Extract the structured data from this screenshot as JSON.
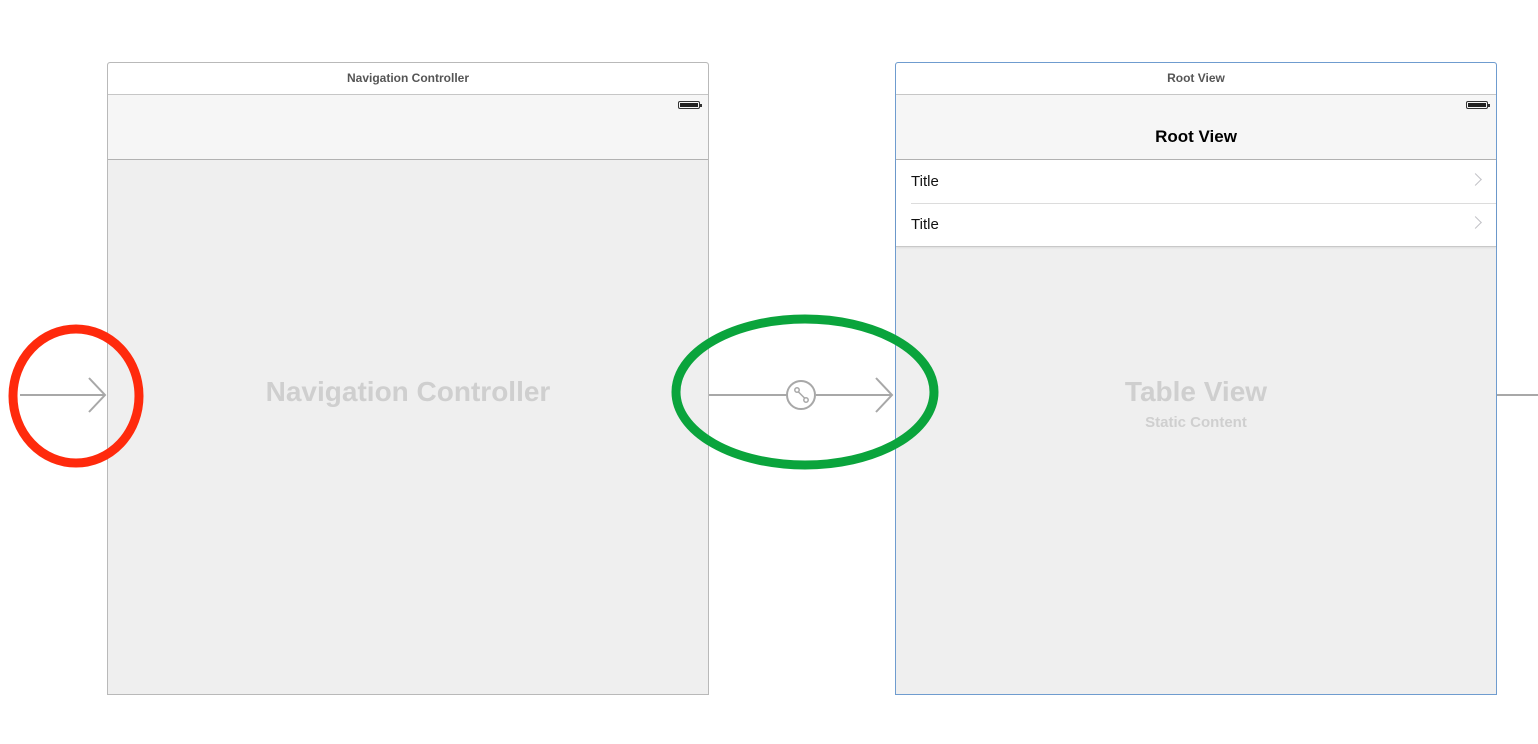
{
  "navigation_controller": {
    "dock_title": "Navigation Controller",
    "placeholder": "Navigation Controller"
  },
  "root_view": {
    "dock_title": "Root View",
    "nav_title": "Root View",
    "cells": [
      {
        "title": "Title"
      },
      {
        "title": "Title"
      }
    ],
    "placeholder_title": "Table View",
    "placeholder_subtitle": "Static Content"
  },
  "segues": {
    "entry_point_icon": "initial-view-controller-arrow-icon",
    "relationship_icon": "relationship-segue-icon"
  },
  "annotations": {
    "entry_highlight_color": "#ff2a0c",
    "segue_highlight_color": "#0aa43c"
  },
  "colors": {
    "selected_scene_border": "#6f9ccf",
    "scene_background": "#efefef",
    "connector_line": "#a8a8a8"
  }
}
